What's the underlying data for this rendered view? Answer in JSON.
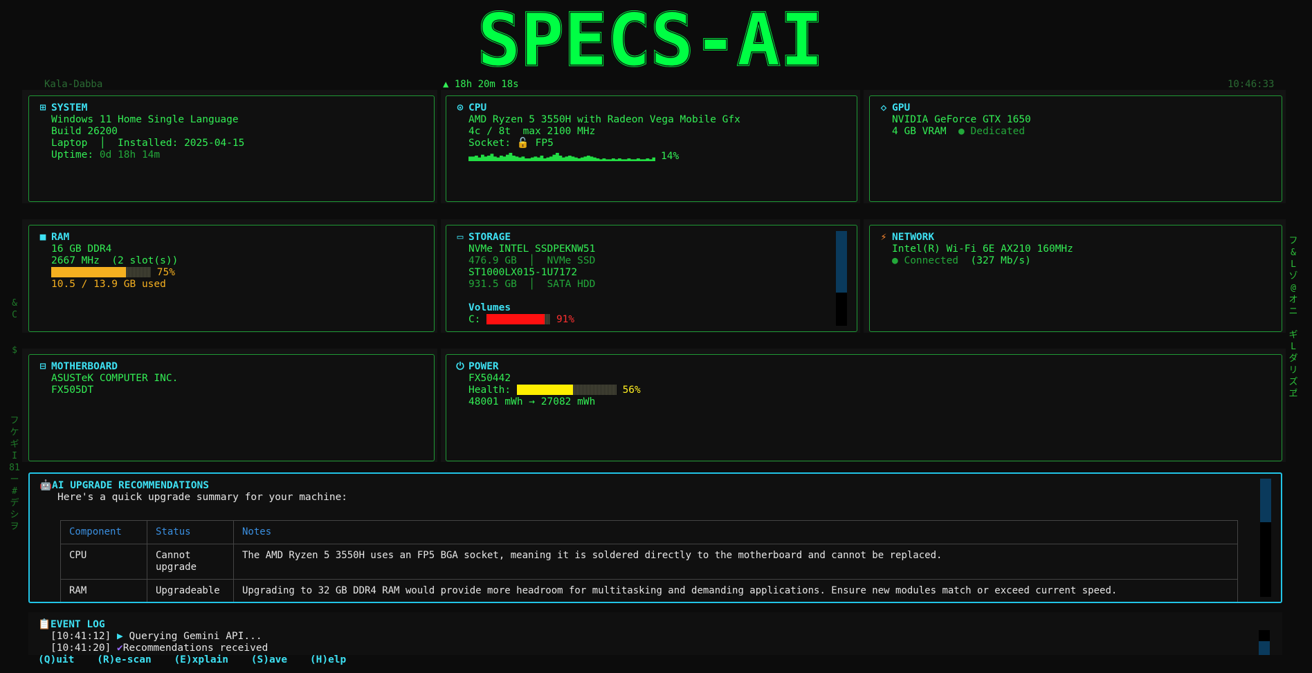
{
  "app": {
    "title": "SPECS-AI",
    "host": "Kala-Dabba",
    "uptime": "▲ 18h 20m 18s",
    "clock": "10:46:33"
  },
  "rain": {
    "left": [
      "&",
      "C",
      "",
      "",
      "$",
      "",
      "",
      "",
      "",
      "",
      "フ",
      "ケ",
      "ギ",
      "I",
      "81",
      "ー",
      "#",
      "デ",
      "シ",
      "ヲ"
    ],
    "right": [
      "フ",
      "&",
      "L",
      "ゾ",
      "@",
      "オ",
      "ニ",
      "",
      "ギ",
      "L",
      "ダ",
      "リ",
      "ズ",
      "ヹ"
    ]
  },
  "system": {
    "title": "SYSTEM",
    "os": "Windows 11 Home Single Language",
    "build": "Build 26200",
    "form": "Laptop",
    "installed": "Installed: 2025-04-15",
    "uptime_label": "Uptime:",
    "uptime_value": "0d 18h 14m"
  },
  "cpu": {
    "title": "CPU",
    "name": "AMD Ryzen 5 3550H with Radeon Vega Mobile Gfx",
    "cores": "4c / 8t  max 2100 MHz",
    "socket_label": "Socket:",
    "socket": "FP5",
    "usage": "14%",
    "usage_value": 14,
    "spark": [
      5,
      5,
      6,
      4,
      7,
      5,
      6,
      8,
      5,
      4,
      6,
      5,
      7,
      9,
      6,
      5,
      4,
      5,
      3,
      3,
      4,
      5,
      4,
      6,
      3,
      4,
      5,
      7,
      9,
      6,
      4,
      5,
      6,
      5,
      4,
      3,
      4,
      5,
      6,
      5,
      4,
      3,
      2,
      3,
      2,
      2,
      3,
      2,
      3,
      2,
      2,
      3,
      2,
      2,
      3,
      2,
      2,
      3,
      2,
      4
    ]
  },
  "gpu": {
    "title": "GPU",
    "name": "NVIDIA GeForce GTX 1650",
    "vram": "4 GB VRAM",
    "type": "● Dedicated"
  },
  "ram": {
    "title": "RAM",
    "size": "16 GB DDR4",
    "speed": "2667 MHz  (2 slot(s))",
    "pct": "75%",
    "pct_value": 0.75,
    "used": "10.5 / 13.9 GB used",
    "color": "#f5b020"
  },
  "storage": {
    "title": "STORAGE",
    "drives": [
      {
        "model": "NVMe INTEL SSDPEKNW51",
        "spec": "476.9 GB  │  NVMe SSD"
      },
      {
        "model": "ST1000LX015-1U7172",
        "spec": "931.5 GB  │  SATA HDD"
      }
    ],
    "volumes_label": "Volumes",
    "volume": "C:",
    "volume_pct": "91%",
    "volume_value": 0.91,
    "scroll": 0.65
  },
  "network": {
    "title": "NETWORK",
    "adapter": "Intel(R) Wi-Fi 6E AX210 160MHz",
    "status": "● Connected",
    "speed": " (327 Mb/s)"
  },
  "motherboard": {
    "title": "MOTHERBOARD",
    "maker": "ASUSTeK COMPUTER INC.",
    "model": "FX505DT"
  },
  "power": {
    "title": "POWER",
    "model": "FX50442",
    "health_label": "Health:",
    "health_pct": "56%",
    "health_value": 0.56,
    "capacity": "48001 mWh → 27082 mWh"
  },
  "ai": {
    "title": "AI UPGRADE RECOMMENDATIONS",
    "summary": "Here's a quick upgrade summary for your machine:",
    "headers": [
      "Component",
      "Status",
      "Notes"
    ],
    "rows": [
      {
        "component": "CPU",
        "status": "Cannot upgrade",
        "notes": "The AMD Ryzen 5 3550H uses an FP5 BGA socket, meaning it is soldered directly to the motherboard and cannot be replaced."
      },
      {
        "component": "RAM",
        "status": "Upgradeable",
        "notes": "Upgrading to 32 GB DDR4 RAM would provide more headroom for multitasking and demanding applications. Ensure new modules match or exceed current speed."
      }
    ],
    "scroll": 0.37
  },
  "log": {
    "title": "EVENT LOG",
    "entries": [
      {
        "time": "[10:41:12]",
        "icon": "▶",
        "text": "Querying Gemini API..."
      },
      {
        "time": "[10:41:20]",
        "icon": "✔",
        "text": "Recommendations received"
      }
    ]
  },
  "keys": [
    "(Q)uit",
    "(R)e-scan",
    "(E)xplain",
    "(S)ave",
    "(H)elp"
  ]
}
